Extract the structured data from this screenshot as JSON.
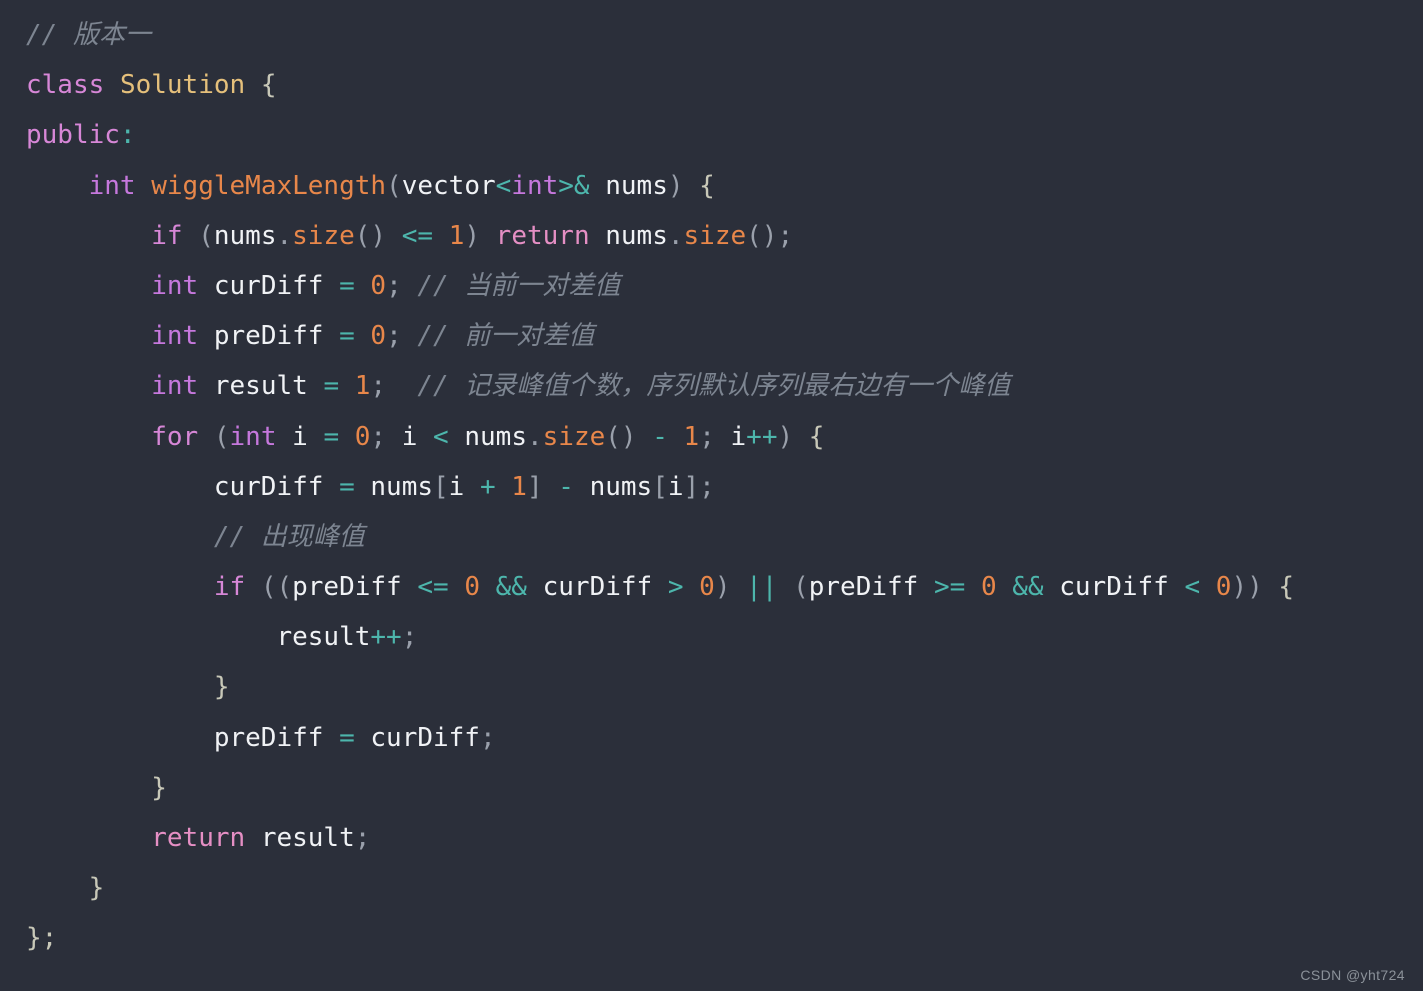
{
  "editor": {
    "background_color": "#2b2f3a",
    "language": "C++",
    "watermark": "CSDN @yht724"
  },
  "theme": {
    "comment": "#7d8591",
    "keyword": "#d787d7",
    "type": "#c678dd",
    "class_name": "#e5c07b",
    "function": "#e8874a",
    "number": "#e8874a",
    "operator": "#4db6ac",
    "variable": "#f0f2f5",
    "punctuation": "#9aa0ab",
    "brace": "#c8c8b8"
  },
  "code": {
    "plain_text": "// 版本一\nclass Solution {\npublic:\n    int wiggleMaxLength(vector<int>& nums) {\n        if (nums.size() <= 1) return nums.size();\n        int curDiff = 0; // 当前一对差值\n        int preDiff = 0; // 前一对差值\n        int result = 1;  // 记录峰值个数，序列默认序列最右边有一个峰值\n        for (int i = 0; i < nums.size() - 1; i++) {\n            curDiff = nums[i + 1] - nums[i];\n            // 出现峰值\n            if ((preDiff <= 0 && curDiff > 0) || (preDiff >= 0 && curDiff < 0)) {\n                result++;\n            }\n            preDiff = curDiff;\n        }\n        return result;\n    }\n};",
    "lines": [
      {
        "indent": "",
        "tokens": [
          {
            "t": "// 版本一",
            "c": "t-com"
          }
        ]
      },
      {
        "indent": "",
        "tokens": [
          {
            "t": "class",
            "c": "t-kw"
          },
          {
            "t": " ",
            "c": "t-var"
          },
          {
            "t": "Solution",
            "c": "t-cls"
          },
          {
            "t": " ",
            "c": "t-var"
          },
          {
            "t": "{",
            "c": "t-brc"
          }
        ]
      },
      {
        "indent": "",
        "tokens": [
          {
            "t": "public",
            "c": "t-kw"
          },
          {
            "t": ":",
            "c": "t-op"
          }
        ]
      },
      {
        "indent": "    ",
        "tokens": [
          {
            "t": "int",
            "c": "t-type"
          },
          {
            "t": " ",
            "c": "t-var"
          },
          {
            "t": "wiggleMaxLength",
            "c": "t-fn"
          },
          {
            "t": "(",
            "c": "t-pun"
          },
          {
            "t": "vector",
            "c": "t-var"
          },
          {
            "t": "<",
            "c": "t-op"
          },
          {
            "t": "int",
            "c": "t-type"
          },
          {
            "t": ">",
            "c": "t-op"
          },
          {
            "t": "&",
            "c": "t-op"
          },
          {
            "t": " ",
            "c": "t-var"
          },
          {
            "t": "nums",
            "c": "t-var"
          },
          {
            "t": ")",
            "c": "t-pun"
          },
          {
            "t": " ",
            "c": "t-var"
          },
          {
            "t": "{",
            "c": "t-brc"
          }
        ]
      },
      {
        "indent": "        ",
        "tokens": [
          {
            "t": "if",
            "c": "t-kw"
          },
          {
            "t": " ",
            "c": "t-var"
          },
          {
            "t": "(",
            "c": "t-pun"
          },
          {
            "t": "nums",
            "c": "t-var"
          },
          {
            "t": ".",
            "c": "t-pun"
          },
          {
            "t": "size",
            "c": "t-fn"
          },
          {
            "t": "()",
            "c": "t-pun"
          },
          {
            "t": " ",
            "c": "t-var"
          },
          {
            "t": "<=",
            "c": "t-op"
          },
          {
            "t": " ",
            "c": "t-var"
          },
          {
            "t": "1",
            "c": "t-num"
          },
          {
            "t": ")",
            "c": "t-pun"
          },
          {
            "t": " ",
            "c": "t-var"
          },
          {
            "t": "return",
            "c": "t-ret"
          },
          {
            "t": " ",
            "c": "t-var"
          },
          {
            "t": "nums",
            "c": "t-var"
          },
          {
            "t": ".",
            "c": "t-pun"
          },
          {
            "t": "size",
            "c": "t-fn"
          },
          {
            "t": "()",
            "c": "t-pun"
          },
          {
            "t": ";",
            "c": "t-pun"
          }
        ]
      },
      {
        "indent": "        ",
        "tokens": [
          {
            "t": "int",
            "c": "t-type"
          },
          {
            "t": " ",
            "c": "t-var"
          },
          {
            "t": "curDiff",
            "c": "t-var"
          },
          {
            "t": " ",
            "c": "t-var"
          },
          {
            "t": "=",
            "c": "t-op"
          },
          {
            "t": " ",
            "c": "t-var"
          },
          {
            "t": "0",
            "c": "t-num"
          },
          {
            "t": ";",
            "c": "t-pun"
          },
          {
            "t": " ",
            "c": "t-var"
          },
          {
            "t": "// 当前一对差值",
            "c": "t-com"
          }
        ]
      },
      {
        "indent": "        ",
        "tokens": [
          {
            "t": "int",
            "c": "t-type"
          },
          {
            "t": " ",
            "c": "t-var"
          },
          {
            "t": "preDiff",
            "c": "t-var"
          },
          {
            "t": " ",
            "c": "t-var"
          },
          {
            "t": "=",
            "c": "t-op"
          },
          {
            "t": " ",
            "c": "t-var"
          },
          {
            "t": "0",
            "c": "t-num"
          },
          {
            "t": ";",
            "c": "t-pun"
          },
          {
            "t": " ",
            "c": "t-var"
          },
          {
            "t": "// 前一对差值",
            "c": "t-com"
          }
        ]
      },
      {
        "indent": "        ",
        "tokens": [
          {
            "t": "int",
            "c": "t-type"
          },
          {
            "t": " ",
            "c": "t-var"
          },
          {
            "t": "result",
            "c": "t-var"
          },
          {
            "t": " ",
            "c": "t-var"
          },
          {
            "t": "=",
            "c": "t-op"
          },
          {
            "t": " ",
            "c": "t-var"
          },
          {
            "t": "1",
            "c": "t-num"
          },
          {
            "t": ";",
            "c": "t-pun"
          },
          {
            "t": "  ",
            "c": "t-var"
          },
          {
            "t": "// 记录峰值个数，序列默认序列最右边有一个峰值",
            "c": "t-com"
          }
        ]
      },
      {
        "indent": "        ",
        "tokens": [
          {
            "t": "for",
            "c": "t-kw"
          },
          {
            "t": " ",
            "c": "t-var"
          },
          {
            "t": "(",
            "c": "t-pun"
          },
          {
            "t": "int",
            "c": "t-type"
          },
          {
            "t": " ",
            "c": "t-var"
          },
          {
            "t": "i",
            "c": "t-var"
          },
          {
            "t": " ",
            "c": "t-var"
          },
          {
            "t": "=",
            "c": "t-op"
          },
          {
            "t": " ",
            "c": "t-var"
          },
          {
            "t": "0",
            "c": "t-num"
          },
          {
            "t": ";",
            "c": "t-pun"
          },
          {
            "t": " ",
            "c": "t-var"
          },
          {
            "t": "i",
            "c": "t-var"
          },
          {
            "t": " ",
            "c": "t-var"
          },
          {
            "t": "<",
            "c": "t-op"
          },
          {
            "t": " ",
            "c": "t-var"
          },
          {
            "t": "nums",
            "c": "t-var"
          },
          {
            "t": ".",
            "c": "t-pun"
          },
          {
            "t": "size",
            "c": "t-fn"
          },
          {
            "t": "()",
            "c": "t-pun"
          },
          {
            "t": " ",
            "c": "t-var"
          },
          {
            "t": "-",
            "c": "t-op"
          },
          {
            "t": " ",
            "c": "t-var"
          },
          {
            "t": "1",
            "c": "t-num"
          },
          {
            "t": ";",
            "c": "t-pun"
          },
          {
            "t": " ",
            "c": "t-var"
          },
          {
            "t": "i",
            "c": "t-var"
          },
          {
            "t": "++",
            "c": "t-op"
          },
          {
            "t": ")",
            "c": "t-pun"
          },
          {
            "t": " ",
            "c": "t-var"
          },
          {
            "t": "{",
            "c": "t-brc"
          }
        ]
      },
      {
        "indent": "            ",
        "tokens": [
          {
            "t": "curDiff",
            "c": "t-var"
          },
          {
            "t": " ",
            "c": "t-var"
          },
          {
            "t": "=",
            "c": "t-op"
          },
          {
            "t": " ",
            "c": "t-var"
          },
          {
            "t": "nums",
            "c": "t-var"
          },
          {
            "t": "[",
            "c": "t-pun"
          },
          {
            "t": "i",
            "c": "t-var"
          },
          {
            "t": " ",
            "c": "t-var"
          },
          {
            "t": "+",
            "c": "t-op"
          },
          {
            "t": " ",
            "c": "t-var"
          },
          {
            "t": "1",
            "c": "t-num"
          },
          {
            "t": "]",
            "c": "t-pun"
          },
          {
            "t": " ",
            "c": "t-var"
          },
          {
            "t": "-",
            "c": "t-op"
          },
          {
            "t": " ",
            "c": "t-var"
          },
          {
            "t": "nums",
            "c": "t-var"
          },
          {
            "t": "[",
            "c": "t-pun"
          },
          {
            "t": "i",
            "c": "t-var"
          },
          {
            "t": "]",
            "c": "t-pun"
          },
          {
            "t": ";",
            "c": "t-pun"
          }
        ]
      },
      {
        "indent": "            ",
        "tokens": [
          {
            "t": "// 出现峰值",
            "c": "t-com"
          }
        ]
      },
      {
        "indent": "            ",
        "tokens": [
          {
            "t": "if",
            "c": "t-kw"
          },
          {
            "t": " ",
            "c": "t-var"
          },
          {
            "t": "((",
            "c": "t-pun"
          },
          {
            "t": "preDiff",
            "c": "t-var"
          },
          {
            "t": " ",
            "c": "t-var"
          },
          {
            "t": "<=",
            "c": "t-op"
          },
          {
            "t": " ",
            "c": "t-var"
          },
          {
            "t": "0",
            "c": "t-num"
          },
          {
            "t": " ",
            "c": "t-var"
          },
          {
            "t": "&&",
            "c": "t-op"
          },
          {
            "t": " ",
            "c": "t-var"
          },
          {
            "t": "curDiff",
            "c": "t-var"
          },
          {
            "t": " ",
            "c": "t-var"
          },
          {
            "t": ">",
            "c": "t-op"
          },
          {
            "t": " ",
            "c": "t-var"
          },
          {
            "t": "0",
            "c": "t-num"
          },
          {
            "t": ")",
            "c": "t-pun"
          },
          {
            "t": " ",
            "c": "t-var"
          },
          {
            "t": "||",
            "c": "t-op"
          },
          {
            "t": " ",
            "c": "t-var"
          },
          {
            "t": "(",
            "c": "t-pun"
          },
          {
            "t": "preDiff",
            "c": "t-var"
          },
          {
            "t": " ",
            "c": "t-var"
          },
          {
            "t": ">=",
            "c": "t-op"
          },
          {
            "t": " ",
            "c": "t-var"
          },
          {
            "t": "0",
            "c": "t-num"
          },
          {
            "t": " ",
            "c": "t-var"
          },
          {
            "t": "&&",
            "c": "t-op"
          },
          {
            "t": " ",
            "c": "t-var"
          },
          {
            "t": "curDiff",
            "c": "t-var"
          },
          {
            "t": " ",
            "c": "t-var"
          },
          {
            "t": "<",
            "c": "t-op"
          },
          {
            "t": " ",
            "c": "t-var"
          },
          {
            "t": "0",
            "c": "t-num"
          },
          {
            "t": "))",
            "c": "t-pun"
          },
          {
            "t": " ",
            "c": "t-var"
          },
          {
            "t": "{",
            "c": "t-brc"
          }
        ]
      },
      {
        "indent": "                ",
        "tokens": [
          {
            "t": "result",
            "c": "t-var"
          },
          {
            "t": "++",
            "c": "t-op"
          },
          {
            "t": ";",
            "c": "t-pun"
          }
        ]
      },
      {
        "indent": "            ",
        "tokens": [
          {
            "t": "}",
            "c": "t-brc"
          }
        ]
      },
      {
        "indent": "            ",
        "tokens": [
          {
            "t": "preDiff",
            "c": "t-var"
          },
          {
            "t": " ",
            "c": "t-var"
          },
          {
            "t": "=",
            "c": "t-op"
          },
          {
            "t": " ",
            "c": "t-var"
          },
          {
            "t": "curDiff",
            "c": "t-var"
          },
          {
            "t": ";",
            "c": "t-pun"
          }
        ]
      },
      {
        "indent": "        ",
        "tokens": [
          {
            "t": "}",
            "c": "t-brc"
          }
        ]
      },
      {
        "indent": "        ",
        "tokens": [
          {
            "t": "return",
            "c": "t-ret"
          },
          {
            "t": " ",
            "c": "t-var"
          },
          {
            "t": "result",
            "c": "t-var"
          },
          {
            "t": ";",
            "c": "t-pun"
          }
        ]
      },
      {
        "indent": "    ",
        "tokens": [
          {
            "t": "}",
            "c": "t-brc"
          }
        ]
      },
      {
        "indent": "",
        "tokens": [
          {
            "t": "};",
            "c": "t-brc"
          }
        ]
      }
    ]
  }
}
